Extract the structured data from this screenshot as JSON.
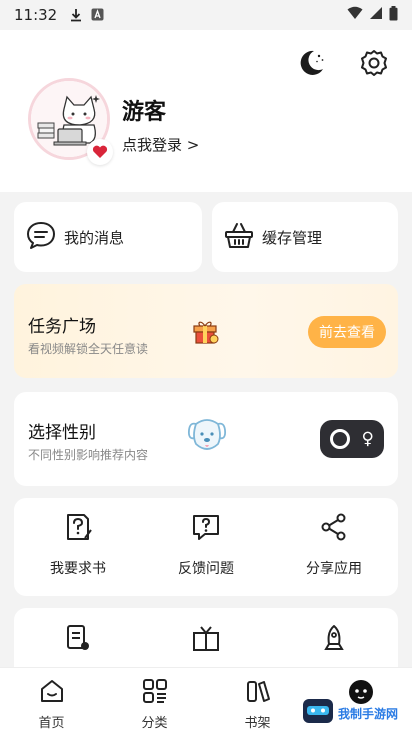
{
  "status_bar": {
    "time": "11:32"
  },
  "profile": {
    "username": "游客",
    "login_text": "点我登录 >"
  },
  "quick": {
    "messages": "我的消息",
    "cache": "缓存管理"
  },
  "task": {
    "title": "任务广场",
    "subtitle": "看视频解锁全天任意读",
    "button": "前去查看"
  },
  "gender": {
    "title": "选择性别",
    "subtitle": "不同性别影响推荐内容",
    "symbol": "♀"
  },
  "actions": [
    {
      "label": "我要求书",
      "icon": "book-request-icon"
    },
    {
      "label": "反馈问题",
      "icon": "feedback-icon"
    },
    {
      "label": "分享应用",
      "icon": "share-icon"
    }
  ],
  "tabs": [
    {
      "label": "首页",
      "icon": "home-icon"
    },
    {
      "label": "分类",
      "icon": "category-icon"
    },
    {
      "label": "书架",
      "icon": "bookshelf-icon"
    },
    {
      "label": "",
      "icon": "profile-icon"
    }
  ],
  "watermark": {
    "text": "我制手游网"
  },
  "colors": {
    "accent": "#ffb347",
    "toggle_bg": "#2e2e33",
    "heart": "#d9253a"
  }
}
